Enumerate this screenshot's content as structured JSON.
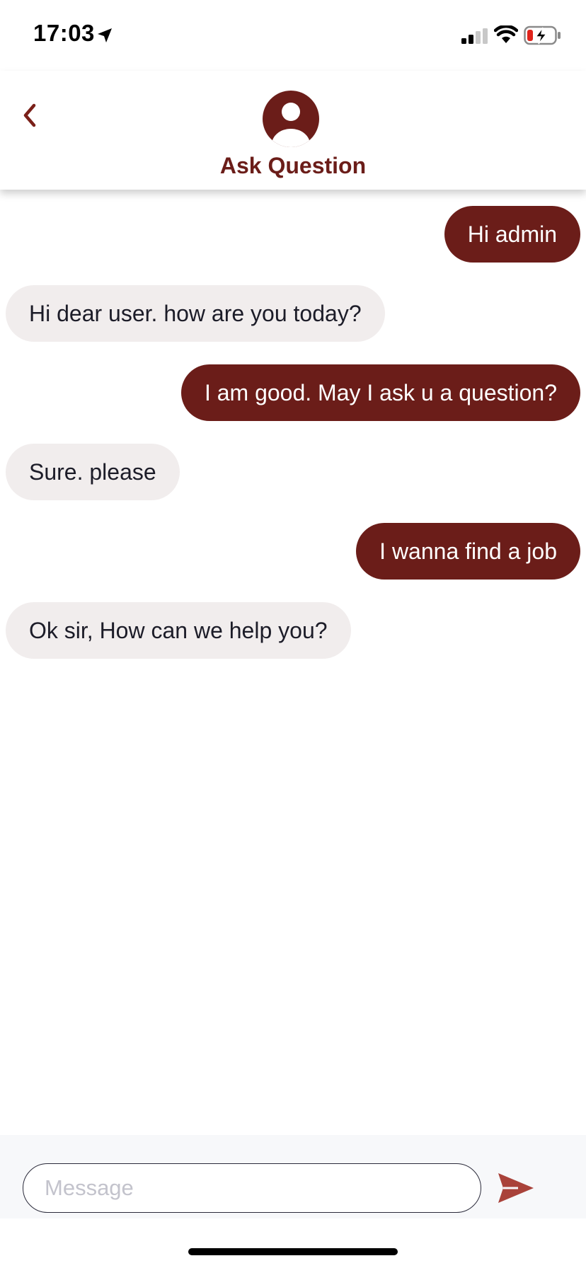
{
  "status_bar": {
    "time": "17:03",
    "icons": [
      "location-arrow-icon",
      "cellular-signal-icon",
      "wifi-icon",
      "battery-charging-icon"
    ]
  },
  "header": {
    "back_icon": "chevron-left-icon",
    "avatar_icon": "user-avatar-icon",
    "title": "Ask Question"
  },
  "messages": [
    {
      "side": "out",
      "text": "Hi admin"
    },
    {
      "side": "in",
      "text": "Hi dear user. how are you today?"
    },
    {
      "side": "out",
      "text": "I am good. May I ask u a question?"
    },
    {
      "side": "in",
      "text": "Sure. please"
    },
    {
      "side": "out",
      "text": "I wanna find a job"
    },
    {
      "side": "in",
      "text": "Ok sir, How can we help you?"
    }
  ],
  "composer": {
    "value": "",
    "placeholder": "Message",
    "send_icon": "send-icon"
  },
  "colors": {
    "accent": "#6b1d19",
    "incoming_bubble": "#f1eded",
    "outgoing_text": "#ffffff",
    "send_icon": "#a9423a"
  }
}
